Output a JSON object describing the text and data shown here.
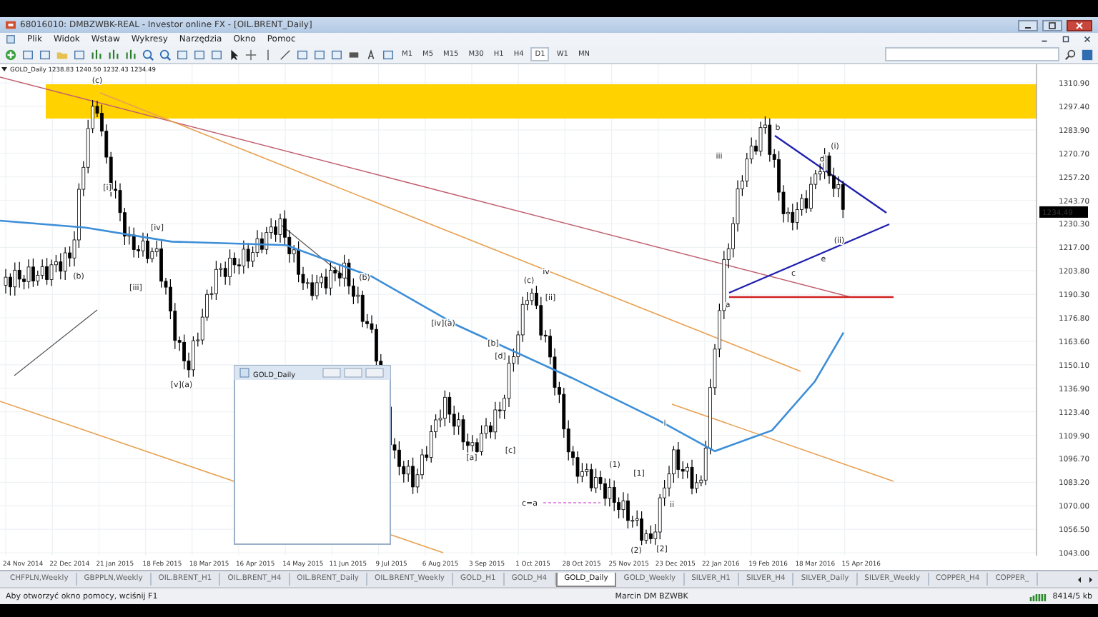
{
  "window": {
    "title": "68016010: DMBZWBK-REAL - Investor online FX - [OIL.BRENT_Daily]"
  },
  "menu": [
    "Plik",
    "Widok",
    "Wstaw",
    "Wykresy",
    "Narzędzia",
    "Okno",
    "Pomoc"
  ],
  "timeframes": [
    {
      "label": "M1",
      "selected": false
    },
    {
      "label": "M5",
      "selected": false
    },
    {
      "label": "M15",
      "selected": false
    },
    {
      "label": "M30",
      "selected": false
    },
    {
      "label": "H1",
      "selected": false
    },
    {
      "label": "H4",
      "selected": false
    },
    {
      "label": "D1",
      "selected": true
    },
    {
      "label": "W1",
      "selected": false
    },
    {
      "label": "MN",
      "selected": false
    }
  ],
  "chart": {
    "info_label": "GOLD_Daily  1238.83 1240.50 1232.43 1234.49",
    "y_axis_labels": [
      "1310.90",
      "1297.40",
      "1283.90",
      "1270.70",
      "1257.20",
      "1243.70",
      "1230.30",
      "1217.00",
      "1203.80",
      "1190.30",
      "1176.80",
      "1163.60",
      "1150.10",
      "1136.90",
      "1123.40",
      "1109.90",
      "1096.70",
      "1083.20",
      "1070.00",
      "1056.50",
      "1043.00"
    ],
    "current_price": "1234.49",
    "x_axis_labels": [
      "24 Nov 2014",
      "22 Dec 2014",
      "21 Jan 2015",
      "18 Feb 2015",
      "18 Mar 2015",
      "16 Apr 2015",
      "14 May 2015",
      "11 Jun 2015",
      "9 Jul 2015",
      "6 Aug 2015",
      "3 Sep 2015",
      "1 Oct 2015",
      "28 Oct 2015",
      "25 Nov 2015",
      "23 Dec 2015",
      "22 Jan 2016",
      "19 Feb 2016",
      "18 Mar 2016",
      "15 Apr 2016"
    ],
    "wave_labels": [
      "(c)",
      "[i]",
      "(b)",
      "[iv]",
      "[iii]",
      "[v](a)",
      "(b)",
      "[iv](a)",
      "[b]",
      "[d]",
      "[c]",
      "[a]",
      "(c)",
      "iv",
      "[ii]",
      "(1)",
      "[1]",
      "(2)",
      "[2]",
      "i",
      "ii",
      "iii",
      "b",
      "a",
      "c",
      "d",
      "(i)",
      "(ii)",
      "e"
    ],
    "projection_label": "c=a",
    "inner_window": {
      "title": "GOLD_Daily"
    }
  },
  "tabs": [
    {
      "label": "CHFPLN,Weekly",
      "selected": false
    },
    {
      "label": "GBPPLN,Weekly",
      "selected": false
    },
    {
      "label": "OIL.BRENT_H1",
      "selected": false
    },
    {
      "label": "OIL.BRENT_H4",
      "selected": false
    },
    {
      "label": "OIL.BRENT_Daily",
      "selected": false
    },
    {
      "label": "OIL.BRENT_Weekly",
      "selected": false
    },
    {
      "label": "GOLD_H1",
      "selected": false
    },
    {
      "label": "GOLD_H4",
      "selected": false
    },
    {
      "label": "GOLD_Daily",
      "selected": true
    },
    {
      "label": "GOLD_Weekly",
      "selected": false
    },
    {
      "label": "SILVER_H1",
      "selected": false
    },
    {
      "label": "SILVER_H4",
      "selected": false
    },
    {
      "label": "SILVER_Daily",
      "selected": false
    },
    {
      "label": "SILVER_Weekly",
      "selected": false
    },
    {
      "label": "COPPER_H4",
      "selected": false
    },
    {
      "label": "COPPER_",
      "selected": false
    }
  ],
  "status_bar": {
    "help": "Aby otworzyć okno pomocy, wciśnij F1",
    "account": "Marcin DM BZWBK",
    "traffic": "8414/5 kb"
  }
}
